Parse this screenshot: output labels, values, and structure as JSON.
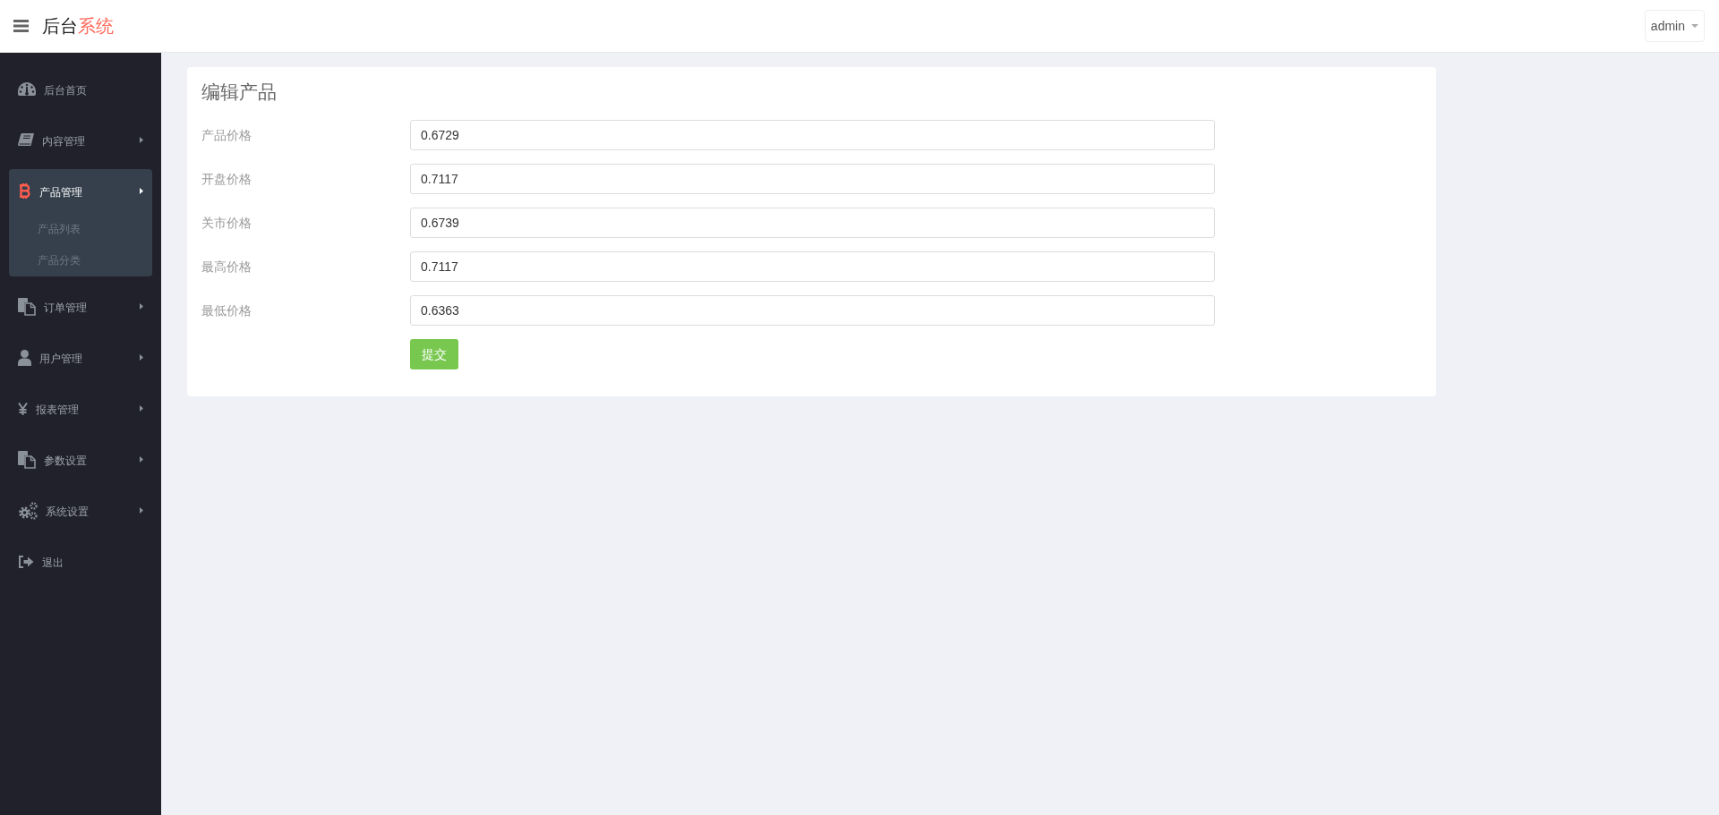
{
  "header": {
    "brand": {
      "main": "后台",
      "accent": "系统"
    },
    "user_menu": {
      "label": "admin"
    }
  },
  "sidebar": {
    "items": [
      {
        "label": "后台首页",
        "submenu": false,
        "expanded": false,
        "selected": false
      },
      {
        "label": "内容管理",
        "submenu": true,
        "expanded": false,
        "selected": false
      },
      {
        "label": "产品管理",
        "submenu": true,
        "expanded": true,
        "selected": true,
        "children": [
          {
            "label": "产品列表",
            "selected": false
          },
          {
            "label": "产品分类",
            "selected": false
          }
        ]
      },
      {
        "label": "订单管理",
        "submenu": true,
        "expanded": false,
        "selected": false
      },
      {
        "label": "用户管理",
        "submenu": true,
        "expanded": false,
        "selected": false
      },
      {
        "label": "报表管理",
        "submenu": true,
        "expanded": false,
        "selected": false
      },
      {
        "label": "参数设置",
        "submenu": true,
        "expanded": false,
        "selected": false
      },
      {
        "label": "系统设置",
        "submenu": true,
        "expanded": false,
        "selected": false
      },
      {
        "label": "退出",
        "submenu": false,
        "expanded": false,
        "selected": false
      }
    ]
  },
  "form": {
    "title": "编辑产品",
    "fields": [
      {
        "label": "产品价格",
        "value": "0.6729"
      },
      {
        "label": "开盘价格",
        "value": "0.7117"
      },
      {
        "label": "关市价格",
        "value": "0.6739"
      },
      {
        "label": "最高价格",
        "value": "0.7117"
      },
      {
        "label": "最低价格",
        "value": "0.6363"
      }
    ],
    "submit": "提交"
  }
}
